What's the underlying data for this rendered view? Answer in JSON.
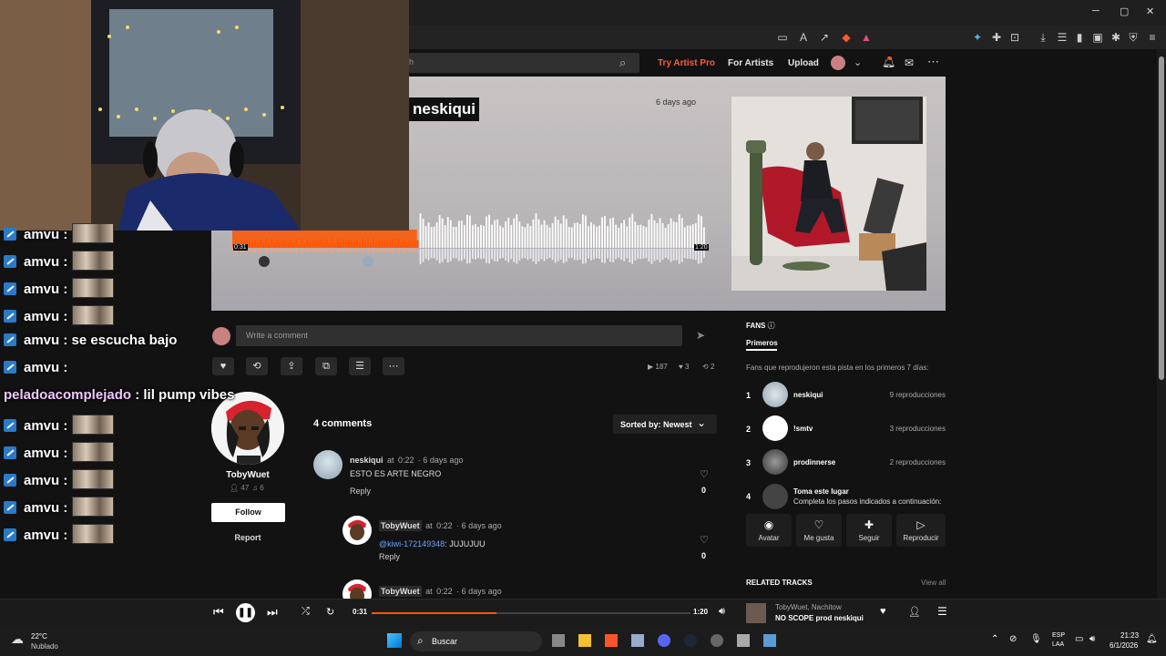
{
  "browser": {
    "window_controls": {
      "minimize": "─",
      "maximize": "▢",
      "close": "✕"
    }
  },
  "header": {
    "search_placeholder": "h",
    "try_artist_pro": "Try Artist Pro",
    "for_artists": "For Artists",
    "upload": "Upload"
  },
  "track": {
    "artist": "neskiqui",
    "posted": "6 days ago",
    "time_elapsed": "0:31",
    "duration": "1:20",
    "progress_fraction": 0.39
  },
  "comment_bar": {
    "placeholder": "Write a comment"
  },
  "stats": {
    "plays": "187",
    "likes": "3",
    "reposts": "2"
  },
  "uploader": {
    "name": "TobyWuet",
    "followers": "47",
    "tracks": "6",
    "follow": "Follow",
    "report": "Report"
  },
  "comments": {
    "count_label": "4 comments",
    "sort_label": "Sorted by: Newest",
    "items": [
      {
        "user": "neskiqui",
        "at": "at",
        "ts": "0:22",
        "ago": "· 6 days ago",
        "mention": "",
        "text": "ESTO ES ARTE NEGRO",
        "reply": "Reply",
        "likes": "0"
      },
      {
        "user": "TobyWuet",
        "at": "at",
        "ts": "0:22",
        "ago": "· 6 days ago",
        "mention": "@kiwi-172149348",
        "text": ": JUJUJUU",
        "reply": "Reply",
        "likes": "0"
      },
      {
        "user": "TobyWuet",
        "at": "at",
        "ts": "0:22",
        "ago": "· 6 days ago",
        "mention": "",
        "text": "",
        "reply": "",
        "likes": ""
      }
    ]
  },
  "fans": {
    "title": "FANS",
    "tab": "Primeros",
    "description": "Fans que reprodujeron esta pista en los primeros 7 días:",
    "list": [
      {
        "rank": "1",
        "name": "neskiqui",
        "count": "9 reproducciones"
      },
      {
        "rank": "2",
        "name": "!smtv",
        "count": "3 reproducciones"
      },
      {
        "rank": "3",
        "name": "prodinnerse",
        "count": "2 reproducciones"
      }
    ],
    "claim": {
      "rank": "4",
      "title": "Toma este lugar",
      "subtitle": "Completa los pasos indicados a continuación:"
    },
    "ctas": [
      {
        "icon": "user-icon",
        "label": "Avatar"
      },
      {
        "icon": "heart-icon",
        "label": "Me gusta"
      },
      {
        "icon": "follow-icon",
        "label": "Seguir"
      },
      {
        "icon": "play-icon",
        "label": "Reproducir"
      }
    ]
  },
  "related": {
    "title": "RELATED TRACKS",
    "view_all": "View all"
  },
  "player": {
    "current": "0:31",
    "total": "1:20",
    "progress_fraction": 0.39,
    "artist": "TobyWuet, Nachitow",
    "title": "NO SCOPE prod neskiqui"
  },
  "taskbar": {
    "temp": "22°C",
    "weather": "Nublado",
    "search": "Buscar",
    "lang1": "ESP",
    "lang2": "LAA",
    "time": "21:23",
    "date": "6/1/2026"
  },
  "chat": [
    {
      "user": "amvu",
      "msg": "",
      "emote": true
    },
    {
      "user": "amvu",
      "msg": "",
      "emote": true
    },
    {
      "user": "amvu",
      "msg": "",
      "emote": true
    },
    {
      "user": "amvu",
      "msg": "",
      "emote": true
    },
    {
      "user": "amvu",
      "msg": "se escucha bajo",
      "emote": false
    },
    {
      "user": "amvu",
      "msg": "",
      "emote": false
    },
    {
      "user": "peladoacomplejado",
      "msg": "lil pump vibes",
      "emote": false
    },
    {
      "user": "amvu",
      "msg": "",
      "emote": true
    },
    {
      "user": "amvu",
      "msg": "",
      "emote": true
    },
    {
      "user": "amvu",
      "msg": "",
      "emote": true
    },
    {
      "user": "amvu",
      "msg": "",
      "emote": true
    },
    {
      "user": "amvu",
      "msg": "",
      "emote": true
    }
  ],
  "colors": {
    "accent": "#ff5500",
    "chat_special_user": "#f1c9ff",
    "badge": "#2a7ac9"
  }
}
